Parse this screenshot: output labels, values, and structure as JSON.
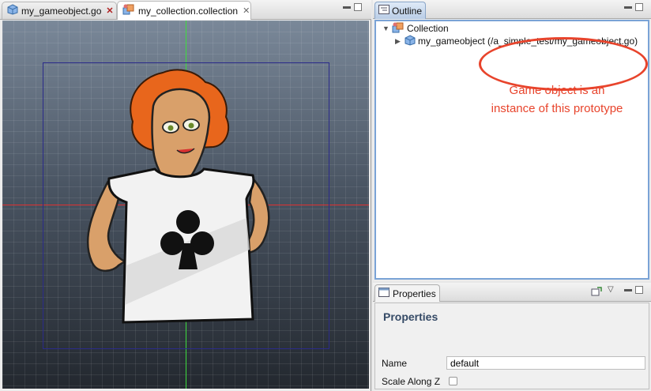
{
  "editor": {
    "tabs": [
      {
        "label": "my_gameobject.go",
        "icon": "gameobject-cube-icon",
        "active": false
      },
      {
        "label": "my_collection.collection",
        "icon": "collection-icon",
        "active": true
      }
    ]
  },
  "outline": {
    "tab_label": "Outline",
    "tree": {
      "root_label": "Collection",
      "child_label": "my_gameobject (/a_simple_test/my_gameobject.go)"
    },
    "annotation": {
      "line1": "Game object is an",
      "line2": "instance of this prototype",
      "color": "#e8442c"
    }
  },
  "properties": {
    "tab_label": "Properties",
    "title": "Properties",
    "name_label": "Name",
    "name_value": "default",
    "scale_label": "Scale Along Z",
    "scale_checked": false
  },
  "colors": {
    "selection_border": "#7aa3d6",
    "axis_x": "#e03030",
    "axis_y": "#3ddc3d",
    "bounds": "#2b2b8a",
    "hair": "#e8661c"
  }
}
